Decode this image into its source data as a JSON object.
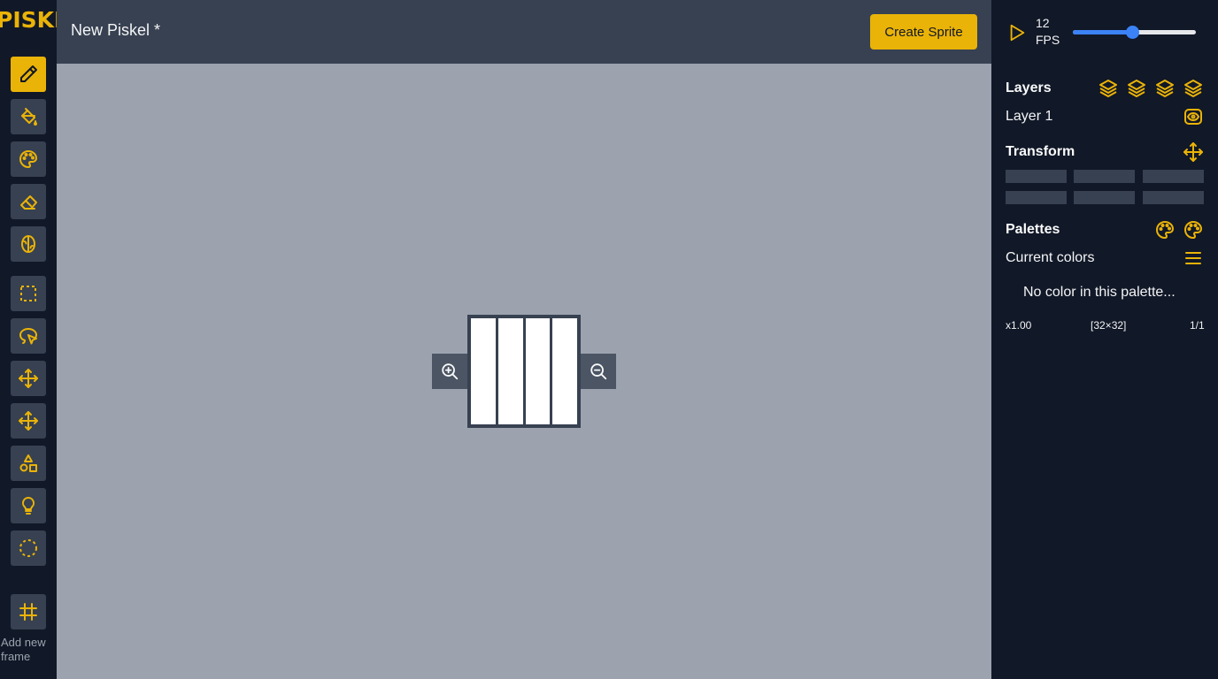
{
  "app": {
    "logo": "PISKEL",
    "title": "New Piskel *",
    "create_button": "Create Sprite",
    "accent": "#eab308"
  },
  "toolbar": {
    "tools": [
      {
        "name": "pen-tool",
        "icon": "pencil-icon",
        "active": true
      },
      {
        "name": "paint-bucket-tool",
        "icon": "paint-bucket-icon",
        "active": false
      },
      {
        "name": "color-picker-tool",
        "icon": "palette-icon",
        "active": false
      },
      {
        "name": "eraser-tool",
        "icon": "eraser-icon",
        "active": false
      },
      {
        "name": "lighten-tool",
        "icon": "brain-icon",
        "active": false
      },
      {
        "name": "rectangle-select-tool",
        "icon": "dashed-square-icon",
        "active": false
      },
      {
        "name": "lasso-select-tool",
        "icon": "lasso-icon",
        "active": false
      },
      {
        "name": "move-tool",
        "icon": "move-icon",
        "active": false
      },
      {
        "name": "pan-tool",
        "icon": "move-icon",
        "active": false
      },
      {
        "name": "shapes-tool",
        "icon": "shapes-icon",
        "active": false
      },
      {
        "name": "dither-tool",
        "icon": "lightbulb-icon",
        "active": false
      },
      {
        "name": "circle-select-tool",
        "icon": "dashed-circle-icon",
        "active": false
      }
    ],
    "add_frame_label": "Add new frame",
    "add_frame_icon": "frame-icon"
  },
  "animation": {
    "fps_value": "12",
    "fps_unit": "FPS",
    "fps_slider_fraction": 0.48
  },
  "layers": {
    "title": "Layers",
    "items": [
      "Layer 1"
    ]
  },
  "transform": {
    "title": "Transform"
  },
  "palettes": {
    "title": "Palettes",
    "current": "Current colors",
    "empty_message": "No color in this palette..."
  },
  "status": {
    "zoom": "x1.00",
    "size": "[32×32]",
    "frame": "1/1"
  }
}
